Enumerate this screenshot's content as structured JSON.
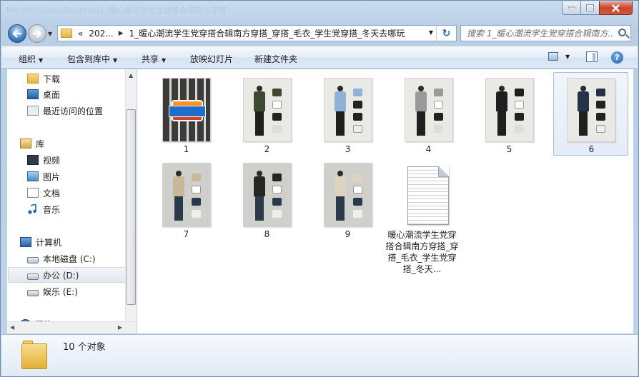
{
  "window": {
    "title_ghost": "file:///C:/Users/Desktop/1_暖心潮流学生党穿搭合辑南方穿搭",
    "buttons": {
      "minimize": "—",
      "maximize": "□",
      "close": "✕"
    }
  },
  "address": {
    "overflow": "«",
    "crumbs": [
      "202...",
      "1_暖心潮流学生党穿搭合辑南方穿搭_穿搭_毛衣_学生党穿搭_冬天去哪玩"
    ],
    "separator": "▶",
    "dropdown": "▼",
    "refresh": "↻"
  },
  "search": {
    "placeholder": "搜索 1_暖心潮流学生党穿搭合辑南方..."
  },
  "toolbar": {
    "items": [
      {
        "label": "组织",
        "arrow": "▼"
      },
      {
        "label": "包含到库中",
        "arrow": "▼"
      },
      {
        "label": "共享",
        "arrow": "▼"
      },
      {
        "label": "放映幻灯片",
        "arrow": ""
      },
      {
        "label": "新建文件夹",
        "arrow": ""
      }
    ],
    "views_arrow": "▼",
    "help": "?"
  },
  "nav": {
    "items": [
      {
        "label": "下载",
        "icon": "download-folder-icon"
      },
      {
        "label": "桌面",
        "icon": "desktop-icon"
      },
      {
        "label": "最近访问的位置",
        "icon": "recent-places-icon"
      },
      {
        "label": "库",
        "icon": "library-icon"
      },
      {
        "label": "视频",
        "icon": "video-icon"
      },
      {
        "label": "图片",
        "icon": "pictures-icon"
      },
      {
        "label": "文档",
        "icon": "documents-icon"
      },
      {
        "label": "音乐",
        "icon": "music-icon"
      },
      {
        "label": "计算机",
        "icon": "computer-icon"
      },
      {
        "label": "本地磁盘 (C:)",
        "icon": "drive-c-icon"
      },
      {
        "label": "办公 (D:)",
        "icon": "drive-d-icon"
      },
      {
        "label": "娱乐 (E:)",
        "icon": "drive-e-icon"
      },
      {
        "label": "网络",
        "icon": "network-icon"
      }
    ],
    "selected": "办公 (D:)",
    "scroll_up": "▲",
    "scroll_down": "▼",
    "scroll_left": "◀",
    "scroll_right": "▶"
  },
  "files": [
    {
      "name": "1",
      "type": "image",
      "variant": "collage"
    },
    {
      "name": "2",
      "type": "image",
      "variant": "green-jacket"
    },
    {
      "name": "3",
      "type": "image",
      "variant": "denim-jacket"
    },
    {
      "name": "4",
      "type": "image",
      "variant": "grey-jacket"
    },
    {
      "name": "5",
      "type": "image",
      "variant": "black-jacket"
    },
    {
      "name": "6",
      "type": "image",
      "variant": "navy-jacket",
      "selected": true
    },
    {
      "name": "7",
      "type": "image",
      "variant": "beige-jacket"
    },
    {
      "name": "8",
      "type": "image",
      "variant": "black-hoodie"
    },
    {
      "name": "9",
      "type": "image",
      "variant": "cream-jacket"
    },
    {
      "name": "暖心潮流学生党穿搭合辑南方穿搭_穿搭_毛衣_学生党穿搭_冬天...",
      "type": "document"
    }
  ],
  "status": {
    "count": "10 个对象"
  }
}
